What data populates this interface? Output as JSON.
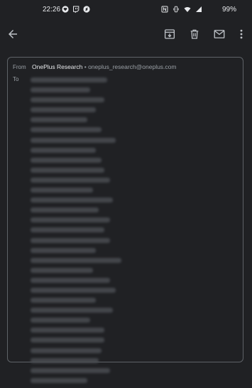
{
  "status_bar": {
    "time": "22:26",
    "battery": "99%",
    "left_icons": [
      "heart-notification-icon",
      "twitch-icon",
      "shazam-icon"
    ],
    "right_icons": [
      "nfc-icon",
      "vibrate-icon",
      "wifi-icon",
      "signal-icon"
    ]
  },
  "toolbar": {
    "back_icon": "arrow-back-icon",
    "archive_icon": "archive-icon",
    "delete_icon": "trash-icon",
    "mark_unread_icon": "mail-icon",
    "more_icon": "more-vert-icon"
  },
  "email_header": {
    "from_label": "From",
    "from_name": "OnePlus Research",
    "separator": "•",
    "from_email": "oneplus_research@oneplus.com",
    "to_label": "To"
  },
  "recipients": [
    {
      "redacted": true,
      "length": 0.54
    },
    {
      "redacted": true,
      "length": 0.42
    },
    {
      "redacted": true,
      "length": 0.52
    },
    {
      "redacted": true,
      "length": 0.46
    },
    {
      "redacted": true,
      "length": 0.4
    },
    {
      "redacted": true,
      "length": 0.5
    },
    {
      "redacted": true,
      "length": 0.6
    },
    {
      "redacted": true,
      "length": 0.46
    },
    {
      "redacted": true,
      "length": 0.5
    },
    {
      "redacted": true,
      "length": 0.52
    },
    {
      "redacted": true,
      "length": 0.56
    },
    {
      "redacted": true,
      "length": 0.44
    },
    {
      "redacted": true,
      "length": 0.58
    },
    {
      "redacted": true,
      "length": 0.48
    },
    {
      "redacted": true,
      "length": 0.56
    },
    {
      "redacted": true,
      "length": 0.52
    },
    {
      "redacted": true,
      "length": 0.56
    },
    {
      "redacted": true,
      "length": 0.46
    },
    {
      "redacted": true,
      "length": 0.64
    },
    {
      "redacted": true,
      "length": 0.44
    },
    {
      "redacted": true,
      "length": 0.56
    },
    {
      "redacted": true,
      "length": 0.6
    },
    {
      "redacted": true,
      "length": 0.46
    },
    {
      "redacted": true,
      "length": 0.58
    },
    {
      "redacted": true,
      "length": 0.42
    },
    {
      "redacted": true,
      "length": 0.52
    },
    {
      "redacted": true,
      "length": 0.52
    },
    {
      "redacted": true,
      "length": 0.5
    },
    {
      "redacted": true,
      "length": 0.48
    },
    {
      "redacted": true,
      "length": 0.56
    },
    {
      "redacted": true,
      "length": 0.4
    }
  ],
  "colors": {
    "background": "#202124",
    "text_primary": "#e8eaed",
    "text_secondary": "#9aa0a6",
    "card_border": "#5f6368",
    "redaction_blur": "#4a4d52"
  }
}
